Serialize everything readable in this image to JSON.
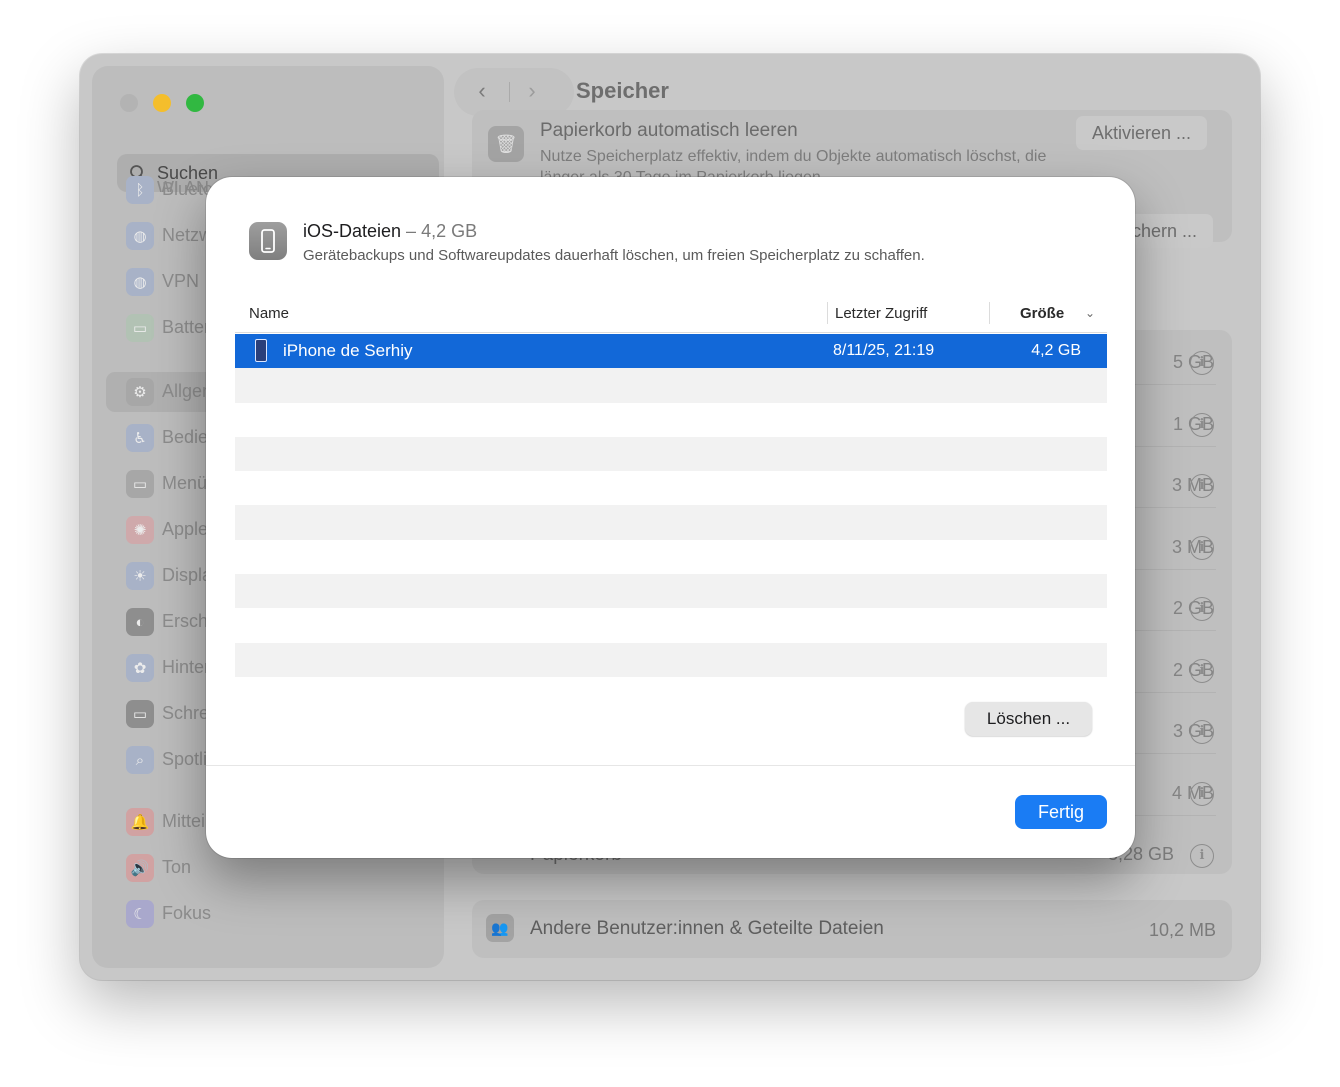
{
  "window": {
    "title": "Speicher"
  },
  "sidebar": {
    "search_placeholder": "Suchen",
    "items": [
      {
        "label": "WLAN",
        "icon": "wifi-icon",
        "color": "#a8b2c7"
      },
      {
        "label": "Bluetooth",
        "icon": "bluetooth-icon",
        "color": "#a8b2c7"
      },
      {
        "label": "Netzwerk",
        "icon": "globe-icon",
        "color": "#a8b2c7"
      },
      {
        "label": "VPN",
        "icon": "vpn-icon",
        "color": "#a8b2c7"
      },
      {
        "label": "Batterie",
        "icon": "battery-icon",
        "color": "#b2c2b4"
      },
      {
        "label": "Allgemein",
        "icon": "gear-icon",
        "color": "#a7a7a7"
      },
      {
        "label": "Bedienungshilfen",
        "icon": "accessibility-icon",
        "color": "#a8b2c7"
      },
      {
        "label": "Menüleiste",
        "icon": "menubar-icon",
        "color": "#a7a7a7"
      },
      {
        "label": "Apple Intelligence & Siri",
        "icon": "siri-icon",
        "color": "#cfa9ab"
      },
      {
        "label": "Displays",
        "icon": "sun-icon",
        "color": "#a8b2c7"
      },
      {
        "label": "Erscheinungsbild",
        "icon": "appearance-icon",
        "color": "#8e8e8e"
      },
      {
        "label": "Hintergrundbild",
        "icon": "flower-icon",
        "color": "#a8b2c7"
      },
      {
        "label": "Schreibtisch & Dock",
        "icon": "dock-icon",
        "color": "#8e8e8e"
      },
      {
        "label": "Spotlight",
        "icon": "magnifier-icon",
        "color": "#a8b2c7"
      },
      {
        "label": "Mitteilungen",
        "icon": "bell-icon",
        "color": "#d1a2a2"
      },
      {
        "label": "Ton",
        "icon": "speaker-icon",
        "color": "#d1a2a2"
      },
      {
        "label": "Fokus",
        "icon": "moon-icon",
        "color": "#a9a8cc"
      }
    ]
  },
  "background": {
    "auto_trash_title": "Papierkorb automatisch leeren",
    "auto_trash_desc": "Nutze Speicherplatz effektiv, indem du Objekte automatisch löschst, die länger als 30 Tage im Papierkorb liegen.",
    "activate_button": "Aktivieren ...",
    "second_button": "chern ...",
    "sizes": [
      "5 GB",
      "1 GB",
      "3 MB",
      "3 MB",
      "2 GB",
      "2 GB",
      "3 GB",
      "4 MB"
    ],
    "trash_label": "Papierkorb",
    "trash_size": "3,28 GB",
    "users_label": "Andere Benutzer:innen & Geteilte Dateien",
    "users_size": "10,2 MB"
  },
  "dialog": {
    "title": "iOS-Dateien",
    "dash": " – ",
    "size": "4,2 GB",
    "subtitle": "Gerätebackups und Softwareupdates dauerhaft löschen, um freien Speicherplatz zu schaffen.",
    "columns": {
      "name": "Name",
      "last_access": "Letzter Zugriff",
      "size": "Größe"
    },
    "rows": [
      {
        "name": "iPhone de Serhiy",
        "last_access": "8/11/25, 21:19",
        "size": "4,2 GB",
        "selected": true
      }
    ],
    "delete_button": "Löschen ...",
    "done_button": "Fertig"
  }
}
